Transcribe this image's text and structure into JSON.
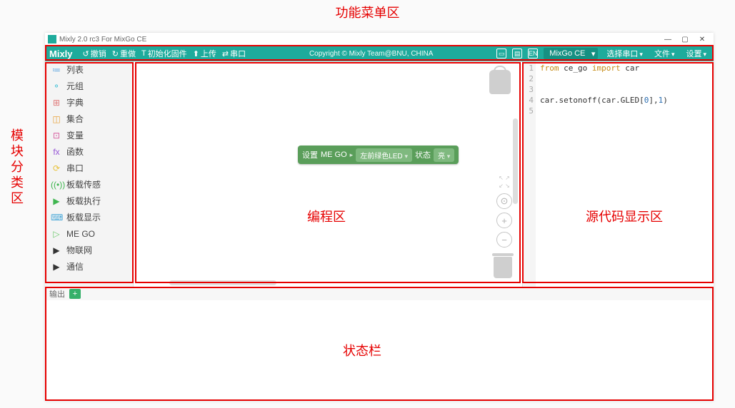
{
  "annotations": {
    "top": "功能菜单区",
    "left": "模块分类区",
    "programming": "编程区",
    "code": "源代码显示区",
    "status": "状态栏"
  },
  "window": {
    "title": "Mixly 2.0 rc3 For MixGo CE"
  },
  "toolbar": {
    "brand": "Mixly",
    "undo": "撤销",
    "redo": "重做",
    "init_firmware": "初始化固件",
    "upload": "上传",
    "serial": "串口",
    "copyright": "Copyright © Mixly Team@BNU, CHINA",
    "board": "MixGo CE",
    "select_port": "选择串口",
    "file": "文件",
    "settings": "设置"
  },
  "categories": [
    {
      "icon": "≔",
      "color": "#5ba5e0",
      "label": "列表"
    },
    {
      "icon": "⚬",
      "color": "#43c1d6",
      "label": "元组"
    },
    {
      "icon": "⊞",
      "color": "#e07979",
      "label": "字典"
    },
    {
      "icon": "◫",
      "color": "#e8a23a",
      "label": "集合"
    },
    {
      "icon": "⊡",
      "color": "#d65a9e",
      "label": "变量"
    },
    {
      "icon": "fx",
      "color": "#9657d6",
      "label": "函数"
    },
    {
      "icon": "⟳",
      "color": "#e8c23a",
      "label": "串口"
    },
    {
      "icon": "((•))",
      "color": "#3fb54f",
      "label": "板载传感"
    },
    {
      "icon": "▶",
      "color": "#3fb54f",
      "label": "板载执行"
    },
    {
      "icon": "⌨",
      "color": "#4aa8d8",
      "label": "板载显示"
    },
    {
      "icon": "▷",
      "color": "#6cc96c",
      "label": "ME GO"
    },
    {
      "icon": "▶",
      "color": "#333",
      "label": "物联网"
    },
    {
      "icon": "▶",
      "color": "#333",
      "label": "通信"
    }
  ],
  "block": {
    "prefix": "设置",
    "device": "ME GO",
    "led_option": "左前绿色LED",
    "state_label": "状态",
    "state_value": "亮"
  },
  "code": {
    "lines": [
      "1",
      "2",
      "3",
      "4",
      "5"
    ],
    "l1_from": "from",
    "l1_mod": "ce_go",
    "l1_import": "import",
    "l1_obj": "car",
    "l4_pre": "car.setonoff(car.GLED[",
    "l4_idx": "0",
    "l4_mid": "],",
    "l4_val": "1",
    "l4_end": ")"
  },
  "status": {
    "output_label": "输出",
    "add": "+"
  }
}
